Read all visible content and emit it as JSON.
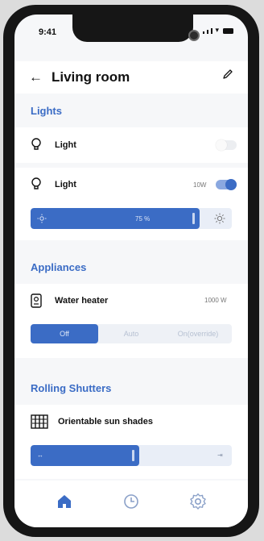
{
  "status_bar": {
    "time": "9:41"
  },
  "header": {
    "title": "Living room"
  },
  "lights": {
    "section_title": "Lights",
    "items": [
      {
        "label": "Light",
        "on": false
      },
      {
        "label": "Light",
        "power": "10W",
        "on": true
      }
    ],
    "brightness": {
      "value_label": "75 %",
      "level": 0.84
    }
  },
  "appliances": {
    "section_title": "Appliances",
    "water_heater": {
      "label": "Water heater",
      "power": "1000 W",
      "modes": [
        "Off",
        "Auto",
        "On(override)"
      ],
      "selected": "Off"
    }
  },
  "shutters": {
    "section_title": "Rolling Shutters",
    "item": {
      "label": "Orientable sun shades",
      "level": 0.54
    }
  },
  "tabs": [
    {
      "icon": "home-icon",
      "active": true
    },
    {
      "icon": "clock-icon",
      "active": false
    },
    {
      "icon": "settings-icon",
      "active": false
    }
  ],
  "colors": {
    "accent": "#3b6cc5",
    "background": "#f6f7f9"
  }
}
